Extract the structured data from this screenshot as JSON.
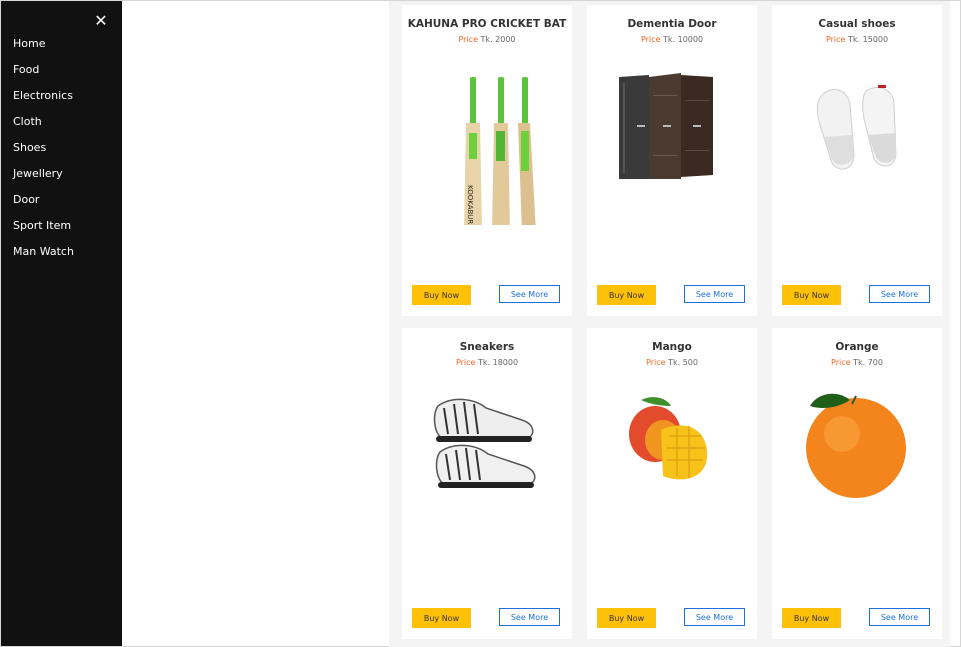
{
  "sidebar": {
    "close_label": "✕",
    "items": [
      {
        "label": "Home"
      },
      {
        "label": "Food"
      },
      {
        "label": "Electronics"
      },
      {
        "label": "Cloth"
      },
      {
        "label": "Shoes"
      },
      {
        "label": "Jewellery"
      },
      {
        "label": "Door"
      },
      {
        "label": "Sport Item"
      },
      {
        "label": "Man Watch"
      }
    ]
  },
  "products": [
    {
      "name": "KAHUNA PRO CRICKET BAT",
      "price_label": "Price",
      "price": "Tk. 2000",
      "image": "cricket-bat-image",
      "buy_label": "Buy Now",
      "see_label": "See More"
    },
    {
      "name": "Dementia Door",
      "price_label": "Price",
      "price": "Tk. 10000",
      "image": "door-image",
      "buy_label": "Buy Now",
      "see_label": "See More"
    },
    {
      "name": "Casual shoes",
      "price_label": "Price",
      "price": "Tk. 15000",
      "image": "casual-shoes-image",
      "buy_label": "Buy Now",
      "see_label": "See More"
    },
    {
      "name": "Sneakers",
      "price_label": "Price",
      "price": "Tk. 18000",
      "image": "sneakers-image",
      "buy_label": "Buy Now",
      "see_label": "See More"
    },
    {
      "name": "Mango",
      "price_label": "Price",
      "price": "Tk. 500",
      "image": "mango-image",
      "buy_label": "Buy Now",
      "see_label": "See More"
    },
    {
      "name": "Orange",
      "price_label": "Price",
      "price": "Tk. 700",
      "image": "orange-image",
      "buy_label": "Buy Now",
      "see_label": "See More"
    }
  ],
  "colors": {
    "sidebar_bg": "#111111",
    "price_label": "#f26522",
    "buy_button": "#ffc107",
    "see_button": "#1e6fd9"
  }
}
